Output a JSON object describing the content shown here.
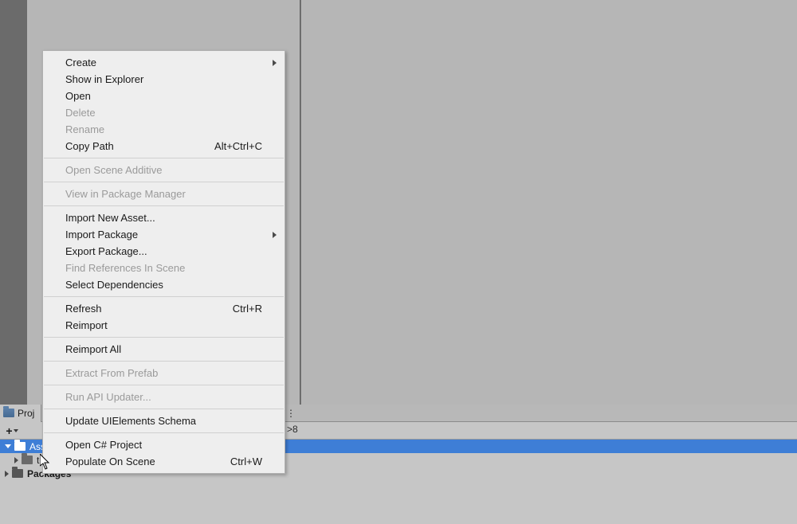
{
  "project": {
    "tab_label": "Proj",
    "toolbar_right": ">8",
    "tree": {
      "assets": "Assets",
      "child1": "tors",
      "packages": "Packages"
    }
  },
  "menu": {
    "create": "Create",
    "show_in_explorer": "Show in Explorer",
    "open": "Open",
    "delete": "Delete",
    "rename": "Rename",
    "copy_path": "Copy Path",
    "copy_path_shortcut": "Alt+Ctrl+C",
    "open_scene_additive": "Open Scene Additive",
    "view_in_package_manager": "View in Package Manager",
    "import_new_asset": "Import New Asset...",
    "import_package": "Import Package",
    "export_package": "Export Package...",
    "find_references": "Find References In Scene",
    "select_dependencies": "Select Dependencies",
    "refresh": "Refresh",
    "refresh_shortcut": "Ctrl+R",
    "reimport": "Reimport",
    "reimport_all": "Reimport All",
    "extract_from_prefab": "Extract From Prefab",
    "run_api_updater": "Run API Updater...",
    "update_uielements": "Update UIElements Schema",
    "open_csharp": "Open C# Project",
    "populate_on_scene": "Populate On Scene",
    "populate_shortcut": "Ctrl+W"
  }
}
